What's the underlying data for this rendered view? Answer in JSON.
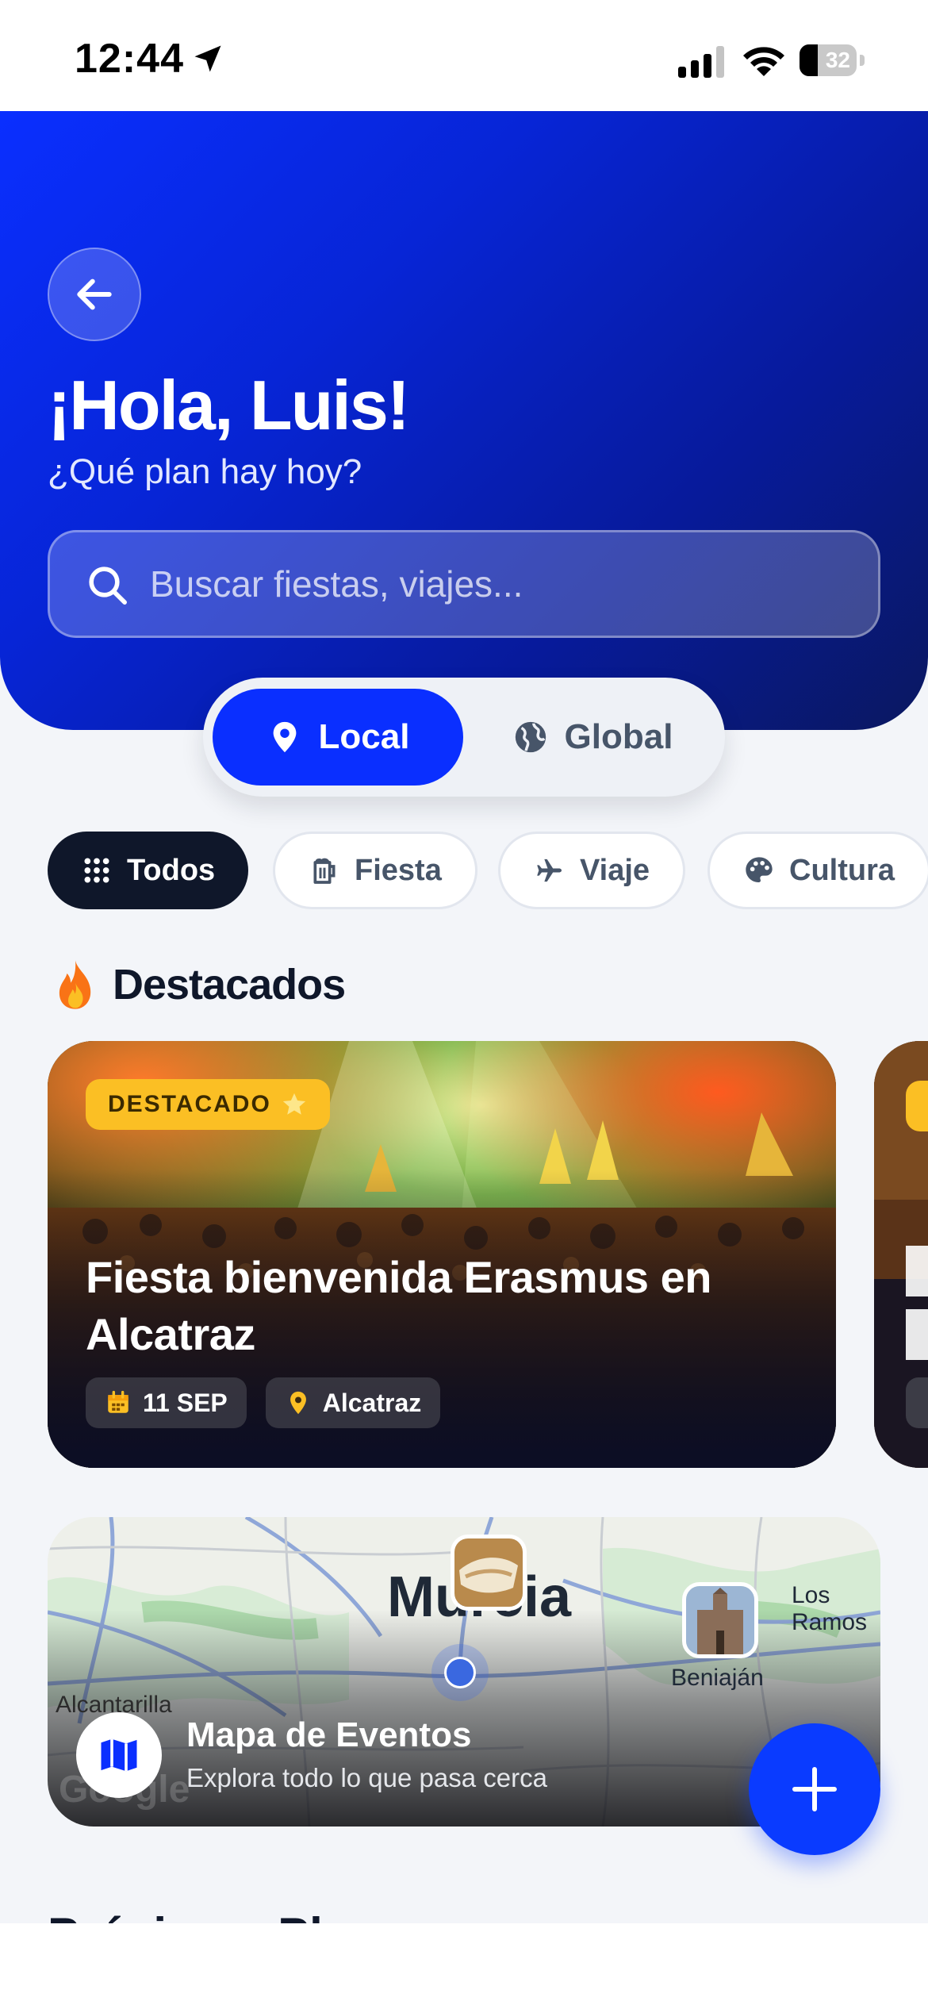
{
  "status_bar": {
    "time": "12:44",
    "battery": "32",
    "battery_level": 0.32
  },
  "hero": {
    "title": "¡Hola, Luis!",
    "subtitle": "¿Qué plan hay hoy?",
    "search_placeholder": "Buscar fiestas, viajes..."
  },
  "segment": {
    "options": [
      "Local",
      "Global"
    ],
    "selected": "Local"
  },
  "filters": [
    {
      "label": "Todos",
      "icon": "grid-icon",
      "selected": true
    },
    {
      "label": "Fiesta",
      "icon": "beer-mug-icon",
      "selected": false
    },
    {
      "label": "Viaje",
      "icon": "airplane-icon",
      "selected": false
    },
    {
      "label": "Cultura",
      "icon": "palette-icon",
      "selected": false
    }
  ],
  "featured": {
    "section_title": "Destacados",
    "cards": [
      {
        "badge": "DESTACADO",
        "title": "Fiesta bienvenida Erasmus en Alcatraz",
        "date": "11 SEP",
        "location": "Alcatraz"
      }
    ]
  },
  "map": {
    "title": "Mapa de Eventos",
    "subtitle": "Explora todo lo que pasa cerca",
    "city_label": "Murcia",
    "places": [
      "Los Ramos",
      "Beniaján",
      "Alcantarilla"
    ],
    "watermark": "Google"
  },
  "next_section": {
    "title": "Próximos Planes"
  },
  "colors": {
    "primary": "#0a2fff",
    "badge": "#fbbf24",
    "dark": "#0f172a"
  }
}
